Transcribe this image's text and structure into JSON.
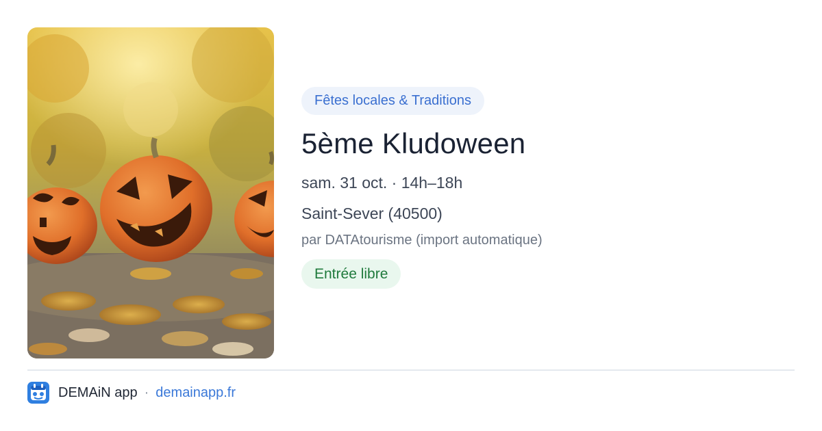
{
  "event": {
    "image_alt": "Citrouilles d'Halloween sculptées sur des feuilles d'automne",
    "category": "Fêtes locales & Traditions",
    "title": "5ème Kludoween",
    "datetime": "sam. 31 oct. · 14h–18h",
    "location": "Saint-Sever (40500)",
    "source": "par DATAtourisme (import automatique)",
    "price": "Entrée libre"
  },
  "footer": {
    "app_icon": "demain-app-icon",
    "app_name": "DEMAiN app",
    "separator": "·",
    "link": "demainapp.fr"
  },
  "colors": {
    "category_text": "#3a6fd0",
    "category_bg": "#eef3fb",
    "price_text": "#1f7a3c",
    "price_bg": "#e9f7ee",
    "link": "#3a78d8",
    "app_icon_bg": "#2f7fe0"
  }
}
